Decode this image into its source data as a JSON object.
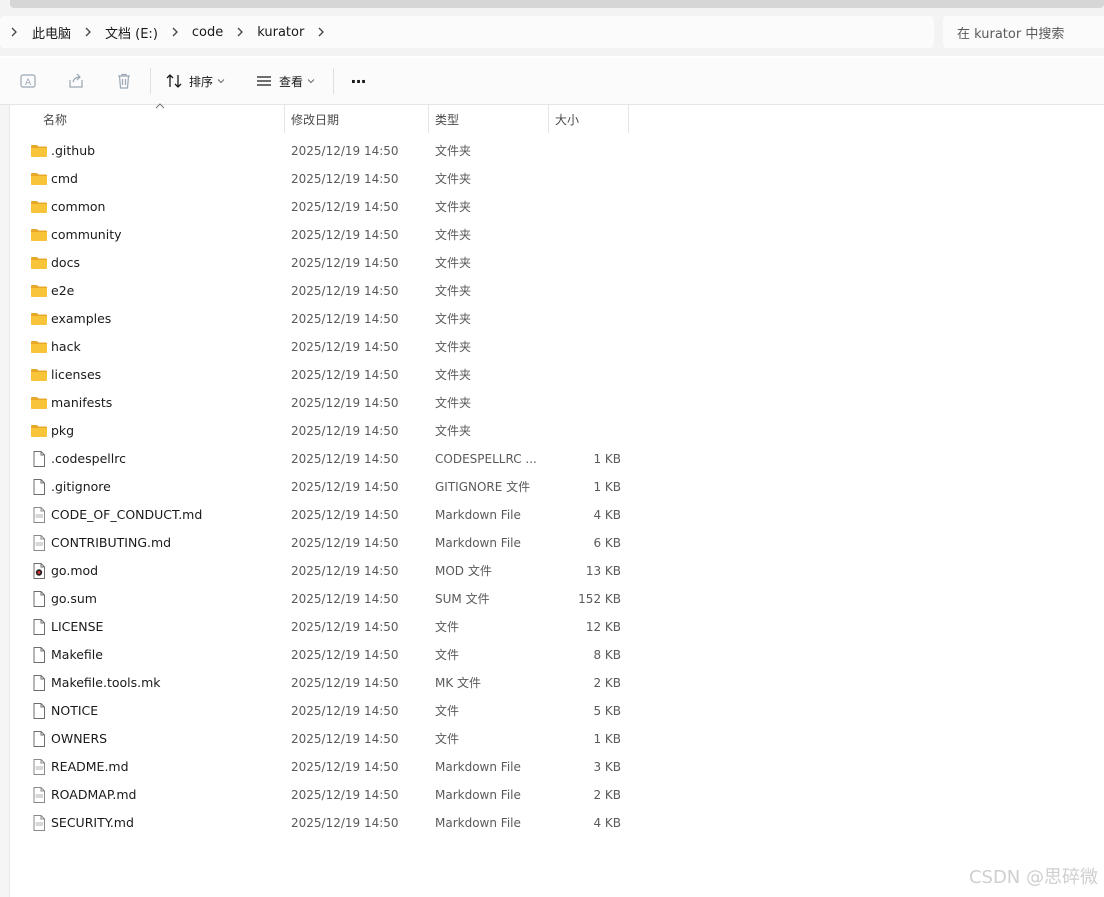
{
  "breadcrumb": {
    "items": [
      "此电脑",
      "文档 (E:)",
      "code",
      "kurator"
    ]
  },
  "search": {
    "placeholder": "在 kurator 中搜索"
  },
  "toolbar": {
    "sort_label": "排序",
    "view_label": "查看",
    "more_label": "···"
  },
  "columns": {
    "name": "名称",
    "date": "修改日期",
    "type": "类型",
    "size": "大小"
  },
  "files": [
    {
      "name": ".github",
      "date": "2025/12/19 14:50",
      "type": "文件夹",
      "size": "",
      "icon": "folder-icon"
    },
    {
      "name": "cmd",
      "date": "2025/12/19 14:50",
      "type": "文件夹",
      "size": "",
      "icon": "folder-icon"
    },
    {
      "name": "common",
      "date": "2025/12/19 14:50",
      "type": "文件夹",
      "size": "",
      "icon": "folder-icon"
    },
    {
      "name": "community",
      "date": "2025/12/19 14:50",
      "type": "文件夹",
      "size": "",
      "icon": "folder-icon"
    },
    {
      "name": "docs",
      "date": "2025/12/19 14:50",
      "type": "文件夹",
      "size": "",
      "icon": "folder-icon"
    },
    {
      "name": "e2e",
      "date": "2025/12/19 14:50",
      "type": "文件夹",
      "size": "",
      "icon": "folder-icon"
    },
    {
      "name": "examples",
      "date": "2025/12/19 14:50",
      "type": "文件夹",
      "size": "",
      "icon": "folder-icon"
    },
    {
      "name": "hack",
      "date": "2025/12/19 14:50",
      "type": "文件夹",
      "size": "",
      "icon": "folder-icon"
    },
    {
      "name": "licenses",
      "date": "2025/12/19 14:50",
      "type": "文件夹",
      "size": "",
      "icon": "folder-icon"
    },
    {
      "name": "manifests",
      "date": "2025/12/19 14:50",
      "type": "文件夹",
      "size": "",
      "icon": "folder-icon"
    },
    {
      "name": "pkg",
      "date": "2025/12/19 14:50",
      "type": "文件夹",
      "size": "",
      "icon": "folder-icon"
    },
    {
      "name": ".codespellrc",
      "date": "2025/12/19 14:50",
      "type": "CODESPELLRC ...",
      "size": "1 KB",
      "icon": "file-icon"
    },
    {
      "name": ".gitignore",
      "date": "2025/12/19 14:50",
      "type": "GITIGNORE 文件",
      "size": "1 KB",
      "icon": "file-icon"
    },
    {
      "name": "CODE_OF_CONDUCT.md",
      "date": "2025/12/19 14:50",
      "type": "Markdown File",
      "size": "4 KB",
      "icon": "markdown-file-icon"
    },
    {
      "name": "CONTRIBUTING.md",
      "date": "2025/12/19 14:50",
      "type": "Markdown File",
      "size": "6 KB",
      "icon": "markdown-file-icon"
    },
    {
      "name": "go.mod",
      "date": "2025/12/19 14:50",
      "type": "MOD 文件",
      "size": "13 KB",
      "icon": "mod-file-icon"
    },
    {
      "name": "go.sum",
      "date": "2025/12/19 14:50",
      "type": "SUM 文件",
      "size": "152 KB",
      "icon": "file-icon"
    },
    {
      "name": "LICENSE",
      "date": "2025/12/19 14:50",
      "type": "文件",
      "size": "12 KB",
      "icon": "file-icon"
    },
    {
      "name": "Makefile",
      "date": "2025/12/19 14:50",
      "type": "文件",
      "size": "8 KB",
      "icon": "file-icon"
    },
    {
      "name": "Makefile.tools.mk",
      "date": "2025/12/19 14:50",
      "type": "MK 文件",
      "size": "2 KB",
      "icon": "file-icon"
    },
    {
      "name": "NOTICE",
      "date": "2025/12/19 14:50",
      "type": "文件",
      "size": "5 KB",
      "icon": "file-icon"
    },
    {
      "name": "OWNERS",
      "date": "2025/12/19 14:50",
      "type": "文件",
      "size": "1 KB",
      "icon": "file-icon"
    },
    {
      "name": "README.md",
      "date": "2025/12/19 14:50",
      "type": "Markdown File",
      "size": "3 KB",
      "icon": "markdown-file-icon"
    },
    {
      "name": "ROADMAP.md",
      "date": "2025/12/19 14:50",
      "type": "Markdown File",
      "size": "2 KB",
      "icon": "markdown-file-icon"
    },
    {
      "name": "SECURITY.md",
      "date": "2025/12/19 14:50",
      "type": "Markdown File",
      "size": "4 KB",
      "icon": "markdown-file-icon"
    }
  ],
  "watermark": "CSDN @思碎微",
  "colors": {
    "folder": "#f8c43a",
    "folder_dark": "#e8a92a",
    "toolbar_icon": "#1a1a1a",
    "disabled_icon": "#9aa7b5"
  }
}
